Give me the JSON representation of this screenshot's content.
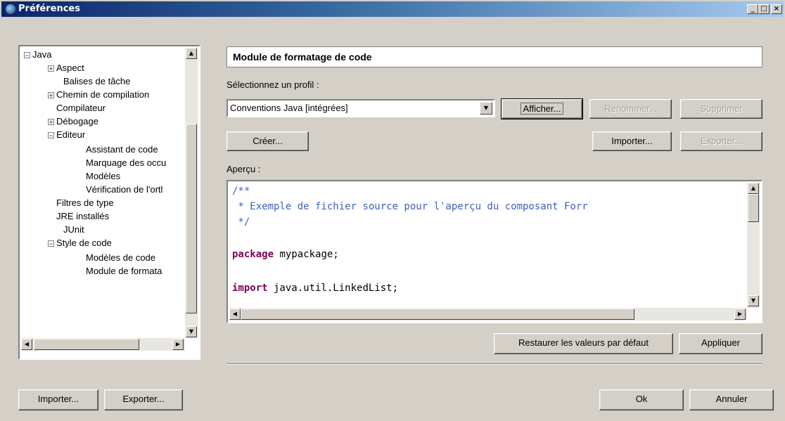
{
  "window": {
    "title": "Préférences",
    "controls": [
      "_",
      "□",
      "×"
    ]
  },
  "tree": {
    "items": [
      {
        "label": "Java",
        "expander": "−"
      },
      {
        "label": "Aspect",
        "expander": "+"
      },
      {
        "label": "Balises de tâche",
        "expander": ""
      },
      {
        "label": "Chemin de compilation",
        "expander": "+"
      },
      {
        "label": "Compilateur",
        "expander": ""
      },
      {
        "label": "Débogage",
        "expander": "+"
      },
      {
        "label": "Editeur",
        "expander": "−"
      },
      {
        "label": "Assistant de code",
        "expander": ""
      },
      {
        "label": "Marquage des occu",
        "expander": ""
      },
      {
        "label": "Modèles",
        "expander": ""
      },
      {
        "label": "Vérification de l'ortl",
        "expander": ""
      },
      {
        "label": "Filtres de type",
        "expander": ""
      },
      {
        "label": "JRE installés",
        "expander": ""
      },
      {
        "label": "JUnit",
        "expander": ""
      },
      {
        "label": "Style de code",
        "expander": "−"
      },
      {
        "label": "Modèles de code",
        "expander": ""
      },
      {
        "label": "Module de formata",
        "expander": ""
      }
    ]
  },
  "panel": {
    "header": "Module de formatage de code",
    "profile_label": "Sélectionnez un profil :",
    "profile_value": "Conventions Java [intégrées]",
    "preview_label": "Aperçu :"
  },
  "buttons": {
    "show": "Afficher...",
    "rename": "Renommer...",
    "delete": "Supprimer",
    "create": "Créer...",
    "import_profile": "Importer...",
    "export_profile": "Exporter...",
    "restore": "Restaurer les valeurs par défaut",
    "apply": "Appliquer",
    "import_prefs": "Importer...",
    "export_prefs": "Exporter...",
    "ok": "Ok",
    "cancel": "Annuler"
  },
  "preview_code": {
    "line1": "/**",
    "line2": " * Exemple de fichier source pour l'aperçu du composant Forr",
    "line3": " */",
    "kw_package": "package",
    "package_rest": " mypackage;",
    "kw_import": "import",
    "import_rest": " java.util.LinkedList;"
  }
}
